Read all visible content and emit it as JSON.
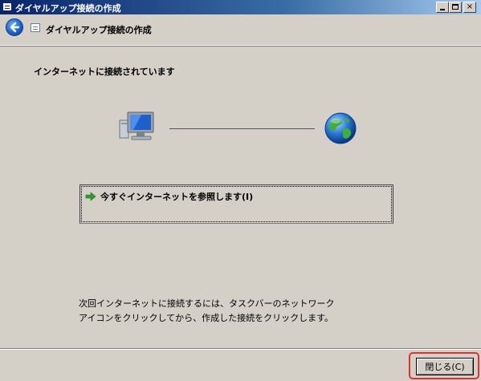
{
  "window": {
    "title": "ダイヤルアップ接続の作成",
    "controls": {
      "minimize": "_",
      "maximize": "□",
      "close": "×"
    }
  },
  "nav": {
    "back_icon": "back-arrow-icon",
    "title": "ダイヤルアップ接続の作成"
  },
  "content": {
    "heading": "インターネットに接続されています",
    "icons": {
      "computer": "computer-icon",
      "globe": "globe-icon"
    },
    "browse_link": "今すぐインターネットを参照します(I)",
    "info_line1": "次回インターネットに接続するには、タスクバーのネットワーク",
    "info_line2": "アイコンをクリックしてから、作成した接続をクリックします。"
  },
  "footer": {
    "close_label": "閉じる(C)"
  },
  "colors": {
    "titlebar_start": "#0a246a",
    "titlebar_end": "#a6caf0",
    "face": "#d4d0c8",
    "highlight": "#e03030"
  }
}
